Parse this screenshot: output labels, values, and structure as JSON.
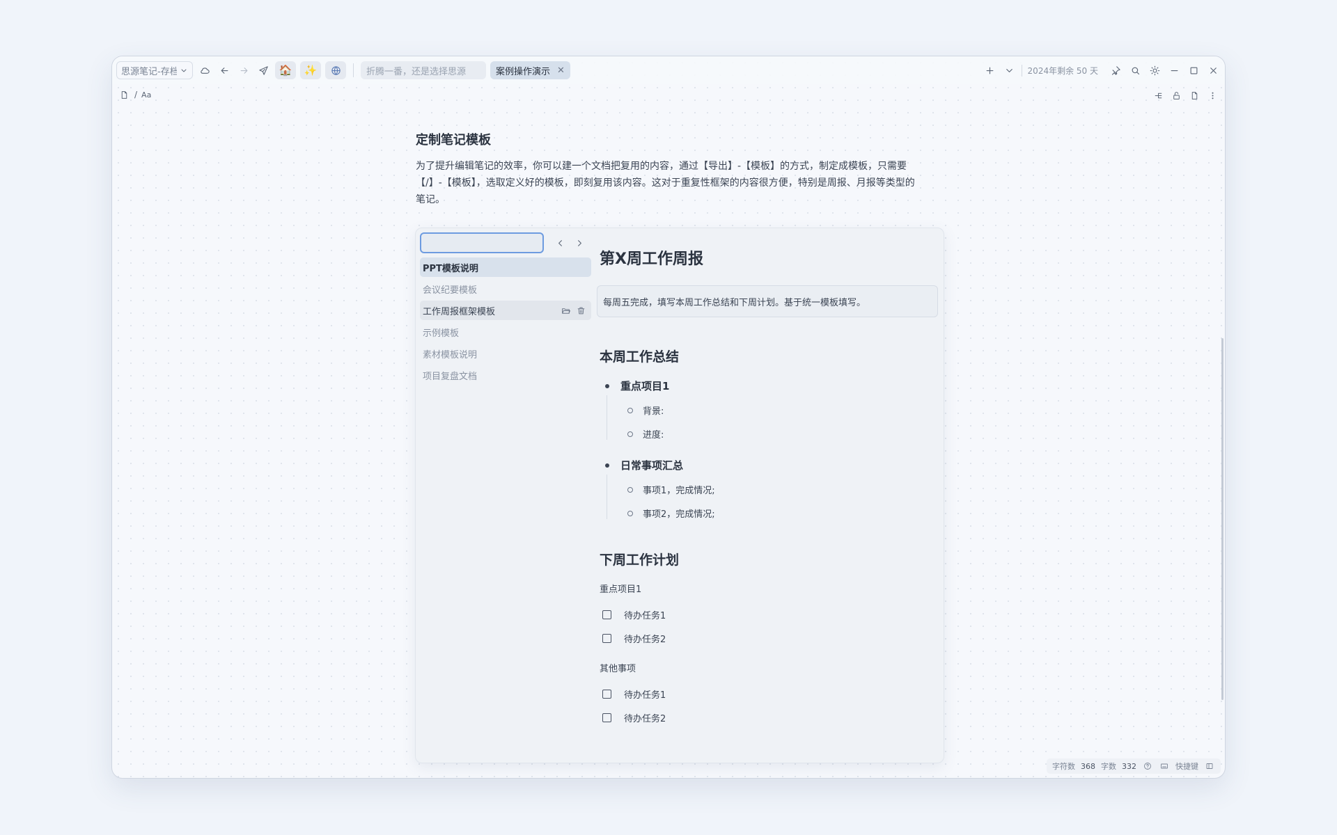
{
  "toolbar": {
    "notebook_select": "思源笔记-存档",
    "ai_placeholder": "折腾一番，还是选择思源",
    "tab_label": "案例操作演示",
    "days_left": "2024年剩余 50 天"
  },
  "breadcrumb": {
    "separator": "/",
    "font_label": "Aa"
  },
  "doc": {
    "heading": "定制笔记模板",
    "paragraph": "为了提升编辑笔记的效率，你可以建一个文档把复用的内容，通过【导出】-【模板】的方式，制定成模板，只需要【/】-【模板】，选取定义好的模板，即刻复用该内容。这对于重复性框架的内容很方便，特别是周报、月报等类型的笔记。"
  },
  "templates": {
    "items": [
      {
        "label": "PPT模板说明"
      },
      {
        "label": "会议纪要模板"
      },
      {
        "label": "工作周报框架模板"
      },
      {
        "label": "示例模板"
      },
      {
        "label": "素材模板说明"
      },
      {
        "label": "项目复盘文档"
      }
    ]
  },
  "preview": {
    "title": "第X周工作周报",
    "callout": "每周五完成，填写本周工作总结和下周计划。基于统一模板填写。",
    "summary_heading": "本周工作总结",
    "group1": "重点项目1",
    "group1_items": [
      "背景:",
      "进度:"
    ],
    "group2": "日常事项汇总",
    "group2_items": [
      "事项1，完成情况;",
      "事项2，完成情况;"
    ],
    "plan_heading": "下周工作计划",
    "plan_sub1": "重点项目1",
    "plan_sub1_tasks": [
      "待办任务1",
      "待办任务2"
    ],
    "plan_sub2": "其他事项",
    "plan_sub2_tasks": [
      "待办任务1",
      "待办任务2"
    ]
  },
  "status": {
    "chars_label": "字符数",
    "chars_value": "368",
    "words_label": "字数",
    "words_value": "332",
    "shortcuts_label": "快捷键"
  },
  "icons": {
    "home": "🏠",
    "sparkle": "✨"
  }
}
